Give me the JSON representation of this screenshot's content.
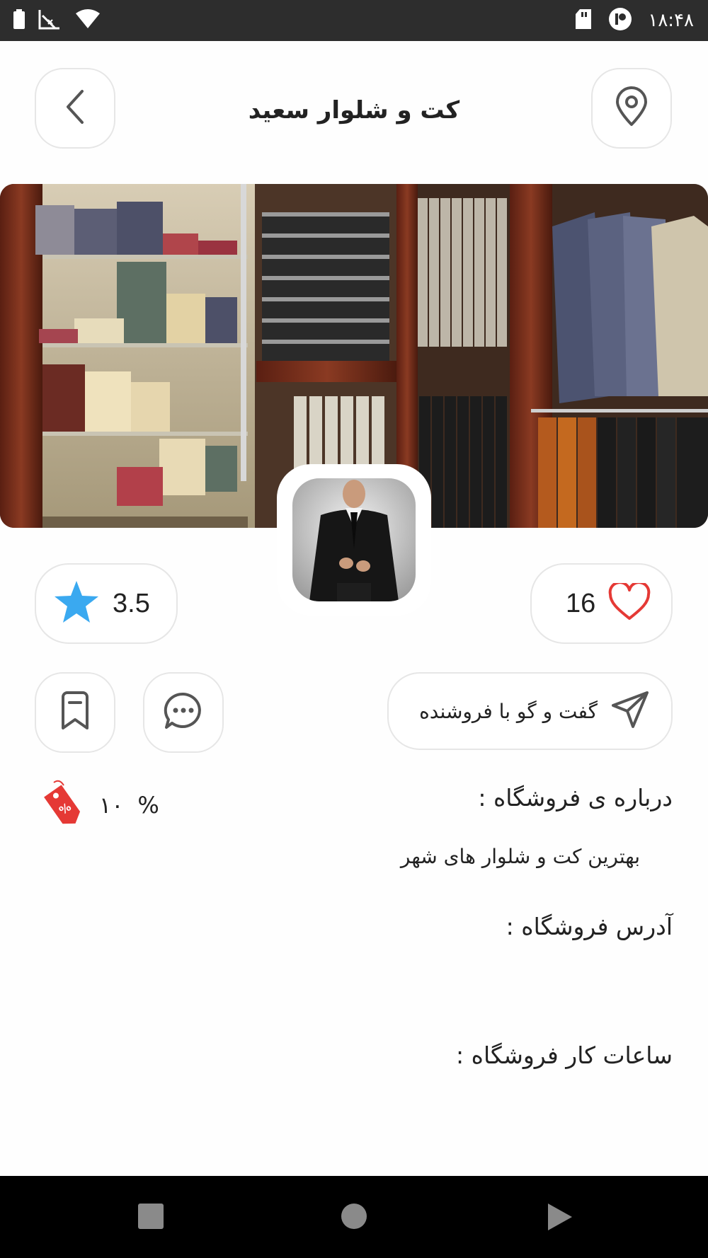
{
  "status_bar": {
    "time": "۱۸:۴۸",
    "icons": [
      "battery-icon",
      "no-signal-icon",
      "wifi-icon",
      "sd-card-icon",
      "app-notification-icon"
    ]
  },
  "header": {
    "title": "کت و شلوار سعید",
    "back_icon": "chevron-left-icon",
    "location_icon": "location-pin-icon"
  },
  "stats": {
    "rating": "3.5",
    "likes": "16"
  },
  "actions": {
    "chat_label": "گفت و گو با فروشنده",
    "chat_icon": "send-icon",
    "message_icon": "chat-bubble-icon",
    "bookmark_icon": "bookmark-icon"
  },
  "about": {
    "title": "درباره ی فروشگاه :",
    "text": "بهترین کت و شلوار های شهر"
  },
  "discount": {
    "value": "۱۰",
    "symbol": "%",
    "icon": "discount-tag-icon"
  },
  "address": {
    "title": "آدرس فروشگاه :"
  },
  "hours": {
    "title": "ساعات کار فروشگاه :"
  },
  "colors": {
    "star": "#3aa9f0",
    "heart": "#e53935",
    "tag": "#e53935",
    "border": "#e6e6e6",
    "status_bar": "#2d2d2d"
  },
  "nav": {
    "items": [
      "recent-apps-icon",
      "home-icon",
      "back-icon"
    ]
  }
}
